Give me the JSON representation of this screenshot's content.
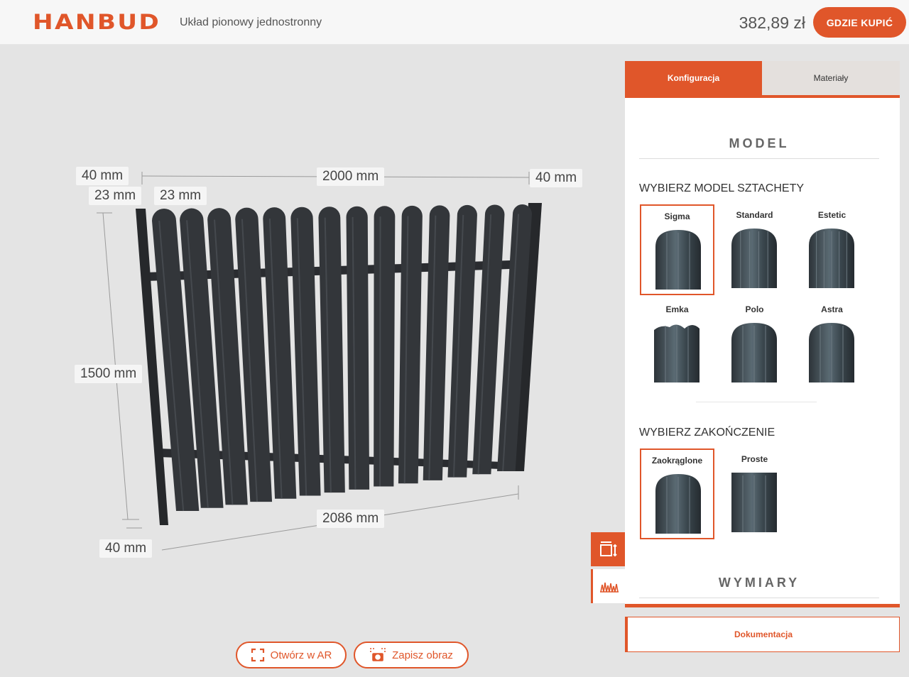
{
  "header": {
    "brand": "HANBUD",
    "subtitle": "Układ pionowy jednostronny",
    "price": "382,89 zł",
    "buy_label": "GDZIE KUPIĆ"
  },
  "viewer": {
    "dimensions": {
      "top_left_post": "40 mm",
      "gap_left_outer": "23 mm",
      "gap_left_inner": "23 mm",
      "width_top": "2000 mm",
      "top_right_post": "40 mm",
      "height": "1500 mm",
      "width_bottom": "2086 mm",
      "bottom_left_post": "40 mm"
    },
    "ar_label": "Otwórz w AR",
    "save_label": "Zapisz obraz"
  },
  "panel": {
    "tabs": [
      {
        "label": "Konfiguracja",
        "active": true
      },
      {
        "label": "Materiały",
        "active": false
      }
    ],
    "model_heading": "MODEL",
    "picket_title": "WYBIERZ MODEL SZTACHETY",
    "pickets": [
      {
        "label": "Sigma",
        "selected": true
      },
      {
        "label": "Standard",
        "selected": false
      },
      {
        "label": "Estetic",
        "selected": false
      },
      {
        "label": "Emka",
        "selected": false
      },
      {
        "label": "Polo",
        "selected": false
      },
      {
        "label": "Astra",
        "selected": false
      }
    ],
    "ending_title": "WYBIERZ ZAKOŃCZENIE",
    "endings": [
      {
        "label": "Zaokrąglone",
        "selected": true
      },
      {
        "label": "Proste",
        "selected": false
      }
    ],
    "dimensions_heading": "WYMIARY"
  },
  "documentation_label": "Dokumentacja",
  "colors": {
    "accent": "#e0562a",
    "fence": "#33363a"
  }
}
